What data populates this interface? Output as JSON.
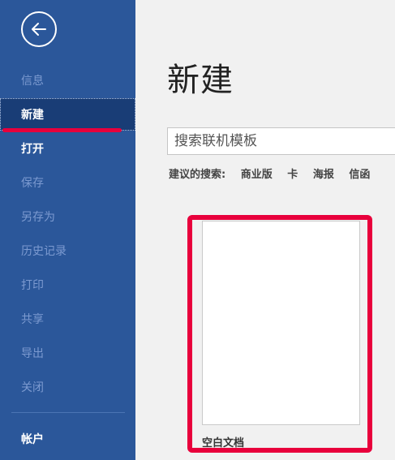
{
  "sidebar": {
    "back_icon": "back-arrow-icon",
    "items": [
      {
        "label": "信息",
        "state": "disabled"
      },
      {
        "label": "新建",
        "state": "active"
      },
      {
        "label": "打开",
        "state": "enabled"
      },
      {
        "label": "保存",
        "state": "disabled"
      },
      {
        "label": "另存为",
        "state": "disabled"
      },
      {
        "label": "历史记录",
        "state": "disabled"
      },
      {
        "label": "打印",
        "state": "disabled"
      },
      {
        "label": "共享",
        "state": "disabled"
      },
      {
        "label": "导出",
        "state": "disabled"
      },
      {
        "label": "关闭",
        "state": "disabled"
      }
    ],
    "account": {
      "label": "帐户"
    }
  },
  "main": {
    "title": "新建",
    "search": {
      "placeholder": "搜索联机模板",
      "value": ""
    },
    "suggested": {
      "label": "建议的搜索:",
      "links": [
        "商业版",
        "卡",
        "海报",
        "信函"
      ]
    },
    "templates": [
      {
        "label": "空白文档"
      }
    ]
  },
  "colors": {
    "sidebar_bg": "#2b579a",
    "active_item_bg": "#193d76",
    "annotation_red": "#e8003c",
    "content_bg": "#f1f1f1"
  }
}
